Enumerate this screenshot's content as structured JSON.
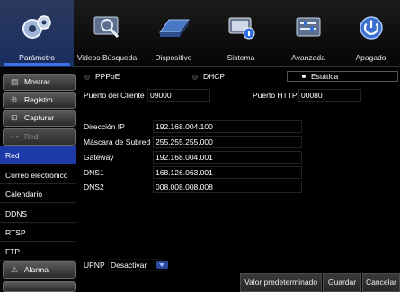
{
  "tabs": [
    {
      "label": "Parámetro",
      "icon": "gears-icon",
      "active": true
    },
    {
      "label": "Videos Búsqueda",
      "icon": "video-search-icon",
      "active": false
    },
    {
      "label": "Dispositivo",
      "icon": "hard-drive-icon",
      "active": false
    },
    {
      "label": "Sistema",
      "icon": "system-info-icon",
      "active": false
    },
    {
      "label": "Avanzada",
      "icon": "advanced-icon",
      "active": false
    },
    {
      "label": "Apagado",
      "icon": "power-icon",
      "active": false
    }
  ],
  "sidebar": {
    "mostrar": "Mostrar",
    "registro": "Registro",
    "capturar": "Capturar",
    "red": "Red",
    "red_sub": "Red",
    "correo": "Correo electrónico",
    "calendario": "Calendario",
    "ddns": "DDNS",
    "rtsp": "RTSP",
    "ftp": "FTP",
    "alarma": "Alarma"
  },
  "network": {
    "mode_pppoe": "PPPoE",
    "mode_dhcp": "DHCP",
    "mode_static": "Estática",
    "selected_mode": "Estática",
    "client_port_label": "Puerto del Cliente",
    "client_port": "09000",
    "http_port_label": "Puerto HTTP",
    "http_port": "00080",
    "ip_label": "Dirección IP",
    "ip": "192.168.004.100",
    "mask_label": "Máscara de Subred",
    "mask": "255.255.255.000",
    "gateway_label": "Gateway",
    "gateway": "192.168.004.001",
    "dns1_label": "DNS1",
    "dns1": "168.126.063.001",
    "dns2_label": "DNS2",
    "dns2": "008.008.008.008",
    "upnp_label": "UPNP",
    "upnp_value": "Desactivar"
  },
  "buttons": {
    "default": "Valor predeterminado",
    "save": "Guardar",
    "cancel": "Cancelar"
  },
  "colors": {
    "active_blue": "#1e3aa8",
    "accent": "#3d70e0"
  }
}
